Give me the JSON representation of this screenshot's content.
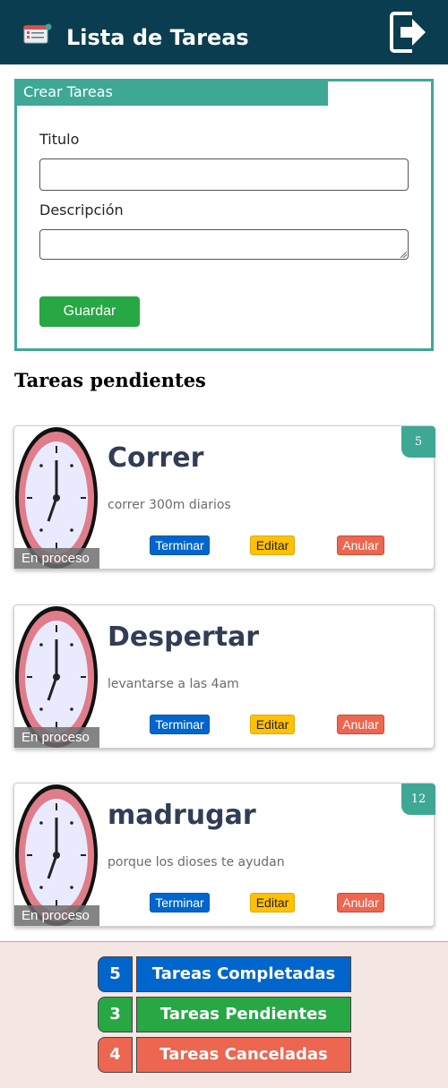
{
  "header": {
    "title": "Lista de Tareas",
    "app_icon": "task-list-icon",
    "logout_icon": "logout-icon"
  },
  "form": {
    "legend": "Crear Tareas",
    "title_label": "Titulo",
    "title_value": "",
    "description_label": "Descripción",
    "description_value": "",
    "save_label": "Guardar"
  },
  "pending": {
    "heading": "Tareas pendientes",
    "tasks": [
      {
        "title": "Correr",
        "description": "correr 300m diarios",
        "status": "En proceso",
        "badge": "5",
        "terminar": "Terminar",
        "editar": "Editar",
        "anular": "Anular"
      },
      {
        "title": "Despertar",
        "description": "levantarse a las 4am",
        "status": "En proceso",
        "badge": "",
        "terminar": "Terminar",
        "editar": "Editar",
        "anular": "Anular"
      },
      {
        "title": "madrugar",
        "description": "porque los dioses te ayudan",
        "status": "En proceso",
        "badge": "12",
        "terminar": "Terminar",
        "editar": "Editar",
        "anular": "Anular"
      }
    ]
  },
  "summary": {
    "completed": {
      "count": "5",
      "label": "Tareas Completadas",
      "color": "#0066cc"
    },
    "pending": {
      "count": "3",
      "label": "Tareas Pendientes",
      "color": "#28a745"
    },
    "cancelled": {
      "count": "4",
      "label": "Tareas Canceladas",
      "color": "#ec6650"
    }
  },
  "colors": {
    "header": "#0a3d50",
    "accent": "#3ea895",
    "footer": "#f3e6e3"
  }
}
